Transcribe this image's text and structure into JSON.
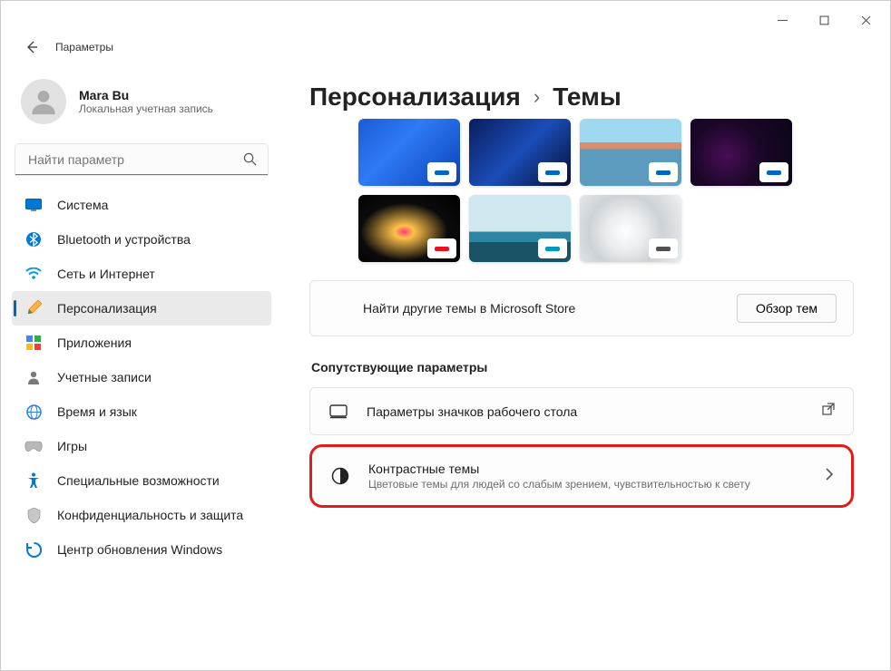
{
  "title": "Параметры",
  "user": {
    "name": "Mara Bu",
    "subtitle": "Локальная учетная запись"
  },
  "search": {
    "placeholder": "Найти параметр"
  },
  "nav": {
    "items": [
      {
        "label": "Система"
      },
      {
        "label": "Bluetooth и устройства"
      },
      {
        "label": "Сеть и Интернет"
      },
      {
        "label": "Персонализация"
      },
      {
        "label": "Приложения"
      },
      {
        "label": "Учетные записи"
      },
      {
        "label": "Время и язык"
      },
      {
        "label": "Игры"
      },
      {
        "label": "Специальные возможности"
      },
      {
        "label": "Конфиденциальность и защита"
      },
      {
        "label": "Центр обновления Windows"
      }
    ]
  },
  "breadcrumb": {
    "parent": "Персонализация",
    "current": "Темы"
  },
  "themes": {
    "chipColors": [
      "#0067c0",
      "#0067c0",
      "#0067c0",
      "#0067c0",
      "#e81123",
      "#0099bc",
      "#505050"
    ]
  },
  "store": {
    "label": "Найти другие темы в Microsoft Store",
    "button": "Обзор тем"
  },
  "related": {
    "title": "Сопутствующие параметры",
    "desktopIcons": "Параметры значков рабочего стола",
    "contrast": {
      "title": "Контрастные темы",
      "sub": "Цветовые темы для людей со слабым зрением, чувствительностью к свету"
    }
  }
}
